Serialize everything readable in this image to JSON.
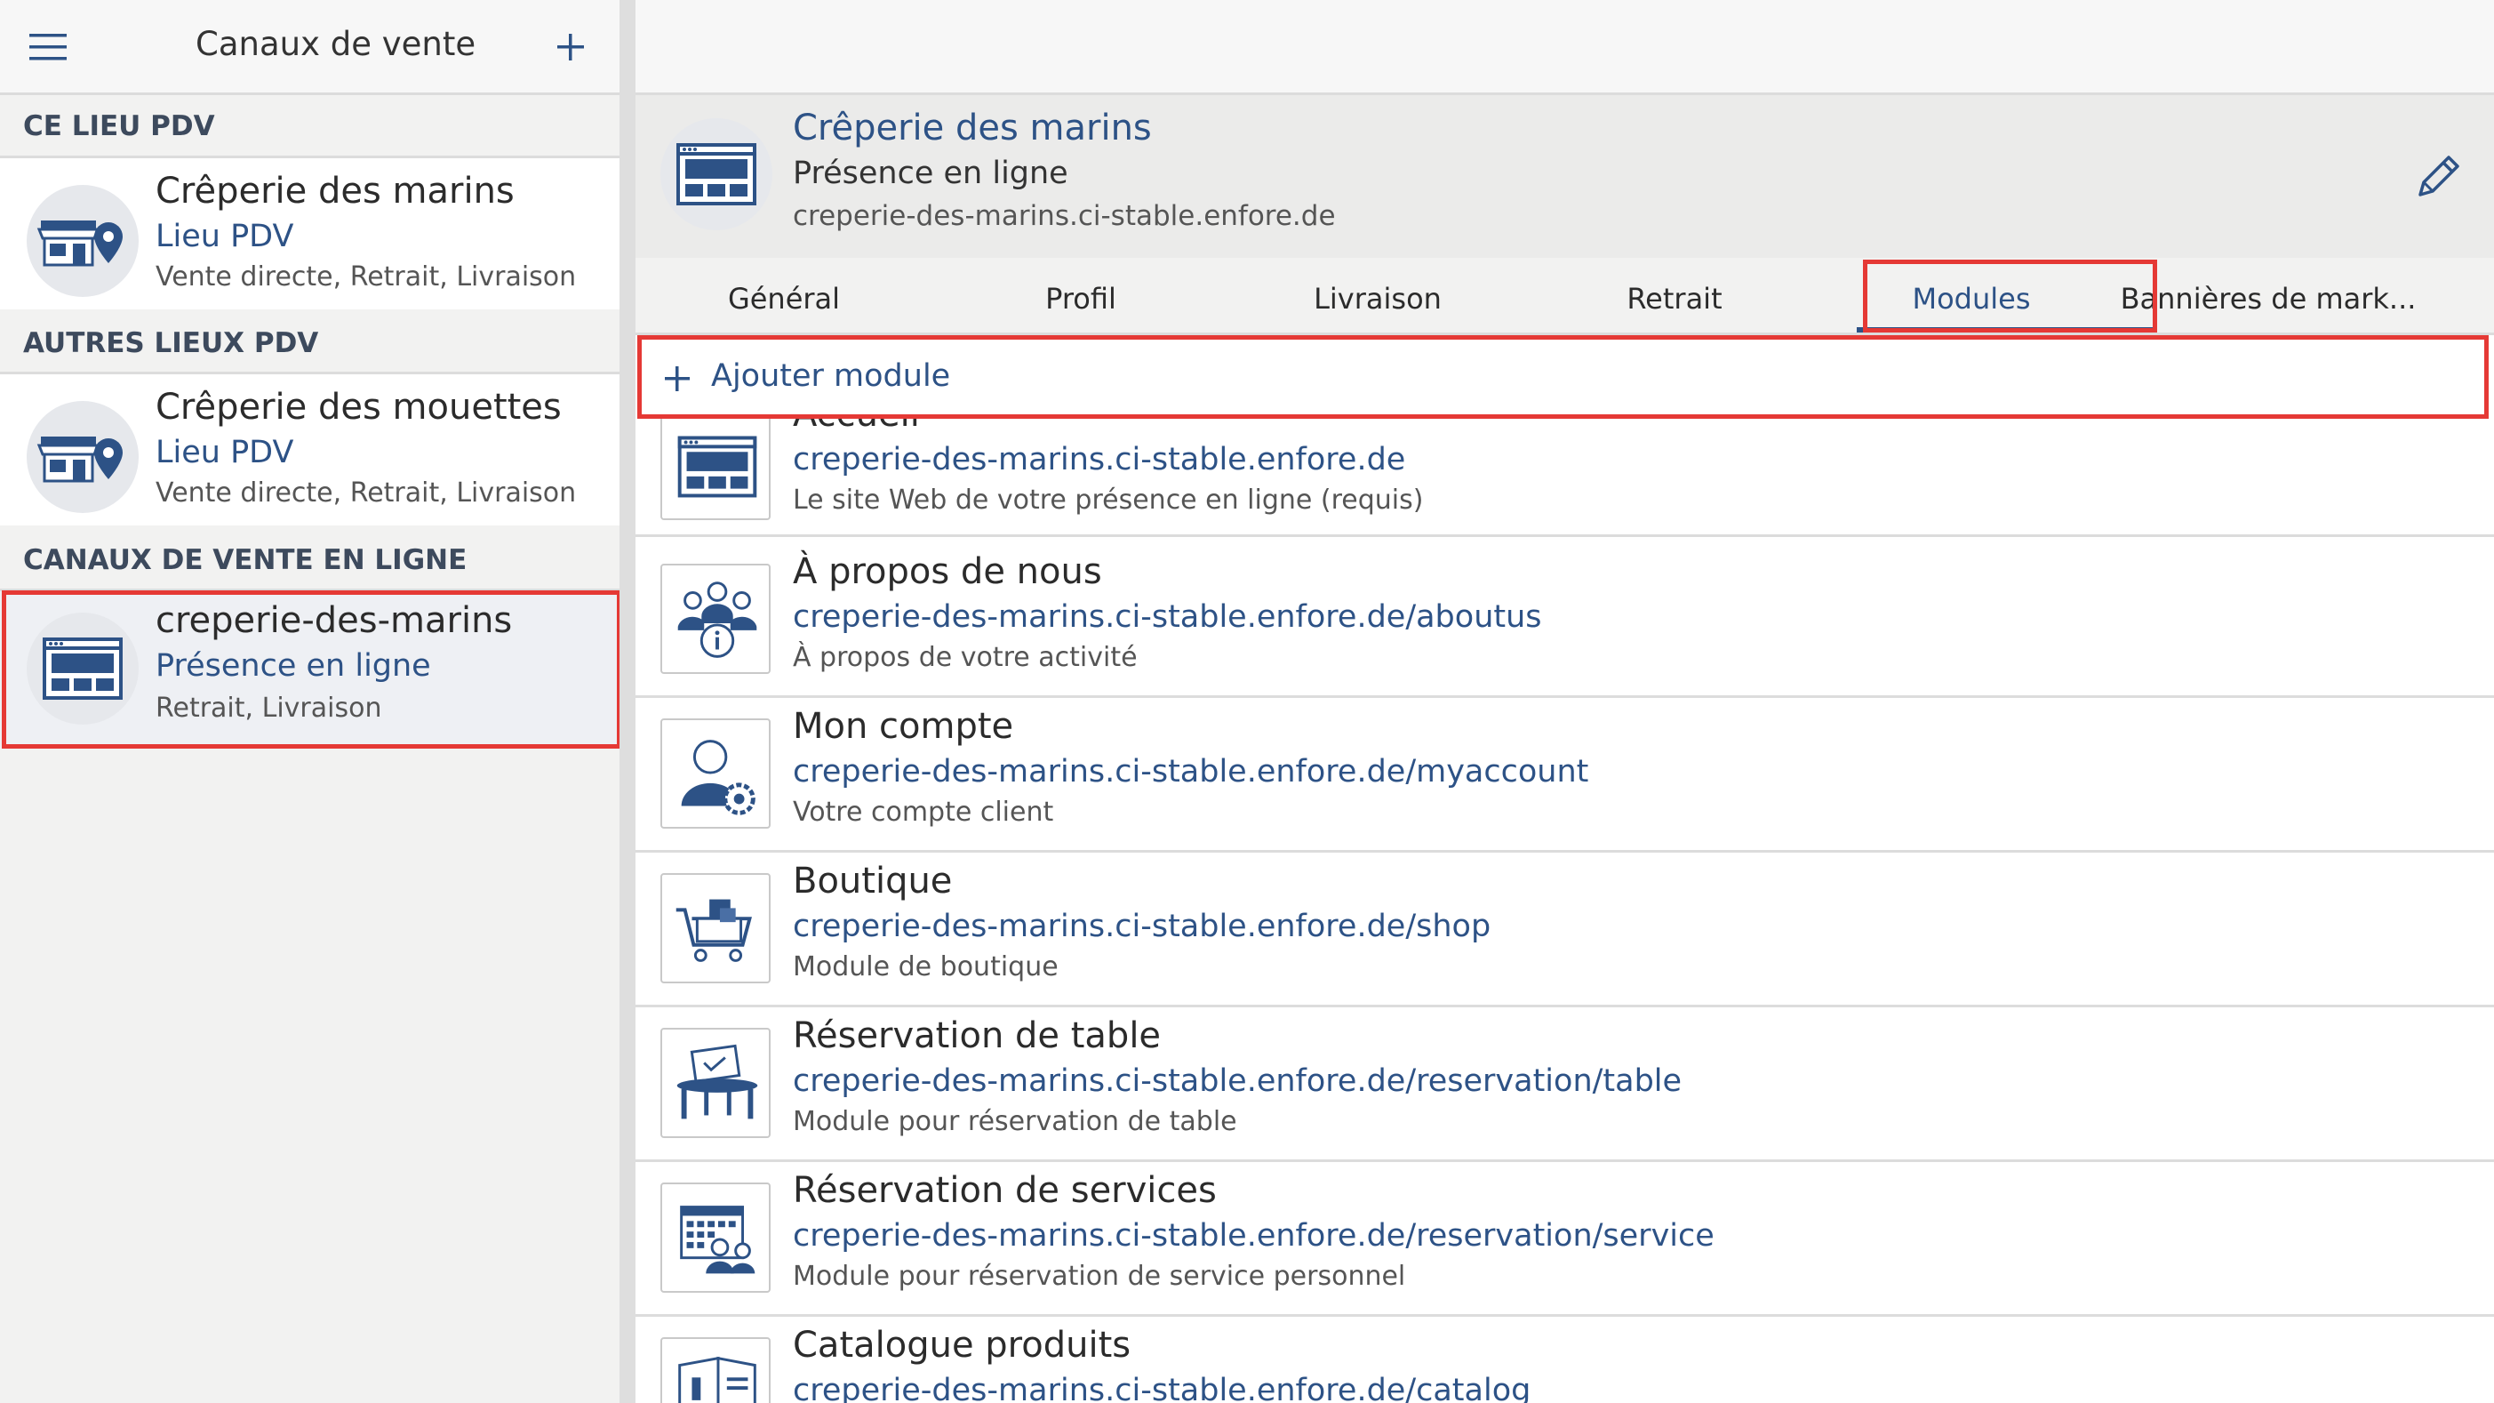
{
  "sidebar": {
    "title": "Canaux de vente",
    "sections": [
      {
        "heading": "CE LIEU PDV",
        "items": [
          {
            "name": "Crêperie des marins",
            "type": "Lieu PDV",
            "details": "Vente directe, Retrait, Livraison",
            "icon": "store-pin-icon"
          }
        ]
      },
      {
        "heading": "AUTRES LIEUX PDV",
        "items": [
          {
            "name": "Crêperie des mouettes",
            "type": "Lieu PDV",
            "details": "Vente directe, Retrait, Livraison",
            "icon": "store-pin-icon"
          }
        ]
      },
      {
        "heading": "CANAUX DE VENTE EN LIGNE",
        "items": [
          {
            "name": "creperie-des-marins",
            "type": "Présence en ligne",
            "details": "Retrait, Livraison",
            "icon": "browser-window-icon",
            "selected": true
          }
        ]
      }
    ]
  },
  "header": {
    "title": "Crêperie des marins",
    "subtitle": "Présence en ligne",
    "url": "creperie-des-marins.ci-stable.enfore.de"
  },
  "tabs": [
    {
      "label": "Général"
    },
    {
      "label": "Profil"
    },
    {
      "label": "Livraison"
    },
    {
      "label": "Retrait"
    },
    {
      "label": "Modules",
      "active": true
    },
    {
      "label": "Bannières de mark..."
    }
  ],
  "add_module_label": "Ajouter module",
  "modules": [
    {
      "title": "Accueil",
      "url": "creperie-des-marins.ci-stable.enfore.de",
      "desc": "Le site Web de votre présence en ligne (requis)",
      "icon": "browser-window-icon"
    },
    {
      "title": "À propos de nous",
      "url": "creperie-des-marins.ci-stable.enfore.de/aboutus",
      "desc": "À propos de votre activité",
      "icon": "team-info-icon"
    },
    {
      "title": "Mon compte",
      "url": "creperie-des-marins.ci-stable.enfore.de/myaccount",
      "desc": "Votre compte client",
      "icon": "user-settings-icon"
    },
    {
      "title": "Boutique",
      "url": "creperie-des-marins.ci-stable.enfore.de/shop",
      "desc": "Module de boutique",
      "icon": "shopping-cart-icon"
    },
    {
      "title": "Réservation de table",
      "url": "creperie-des-marins.ci-stable.enfore.de/reservation/table",
      "desc": "Module pour réservation de table",
      "icon": "table-reservation-icon"
    },
    {
      "title": "Réservation de services",
      "url": "creperie-des-marins.ci-stable.enfore.de/reservation/service",
      "desc": "Module pour réservation de service personnel",
      "icon": "calendar-people-icon"
    },
    {
      "title": "Catalogue produits",
      "url": "creperie-des-marins.ci-stable.enfore.de/catalog",
      "desc": "",
      "icon": "catalog-icon"
    }
  ],
  "colors": {
    "accent": "#2d5286",
    "highlight": "#e53935",
    "background": "#f2f2f1"
  }
}
